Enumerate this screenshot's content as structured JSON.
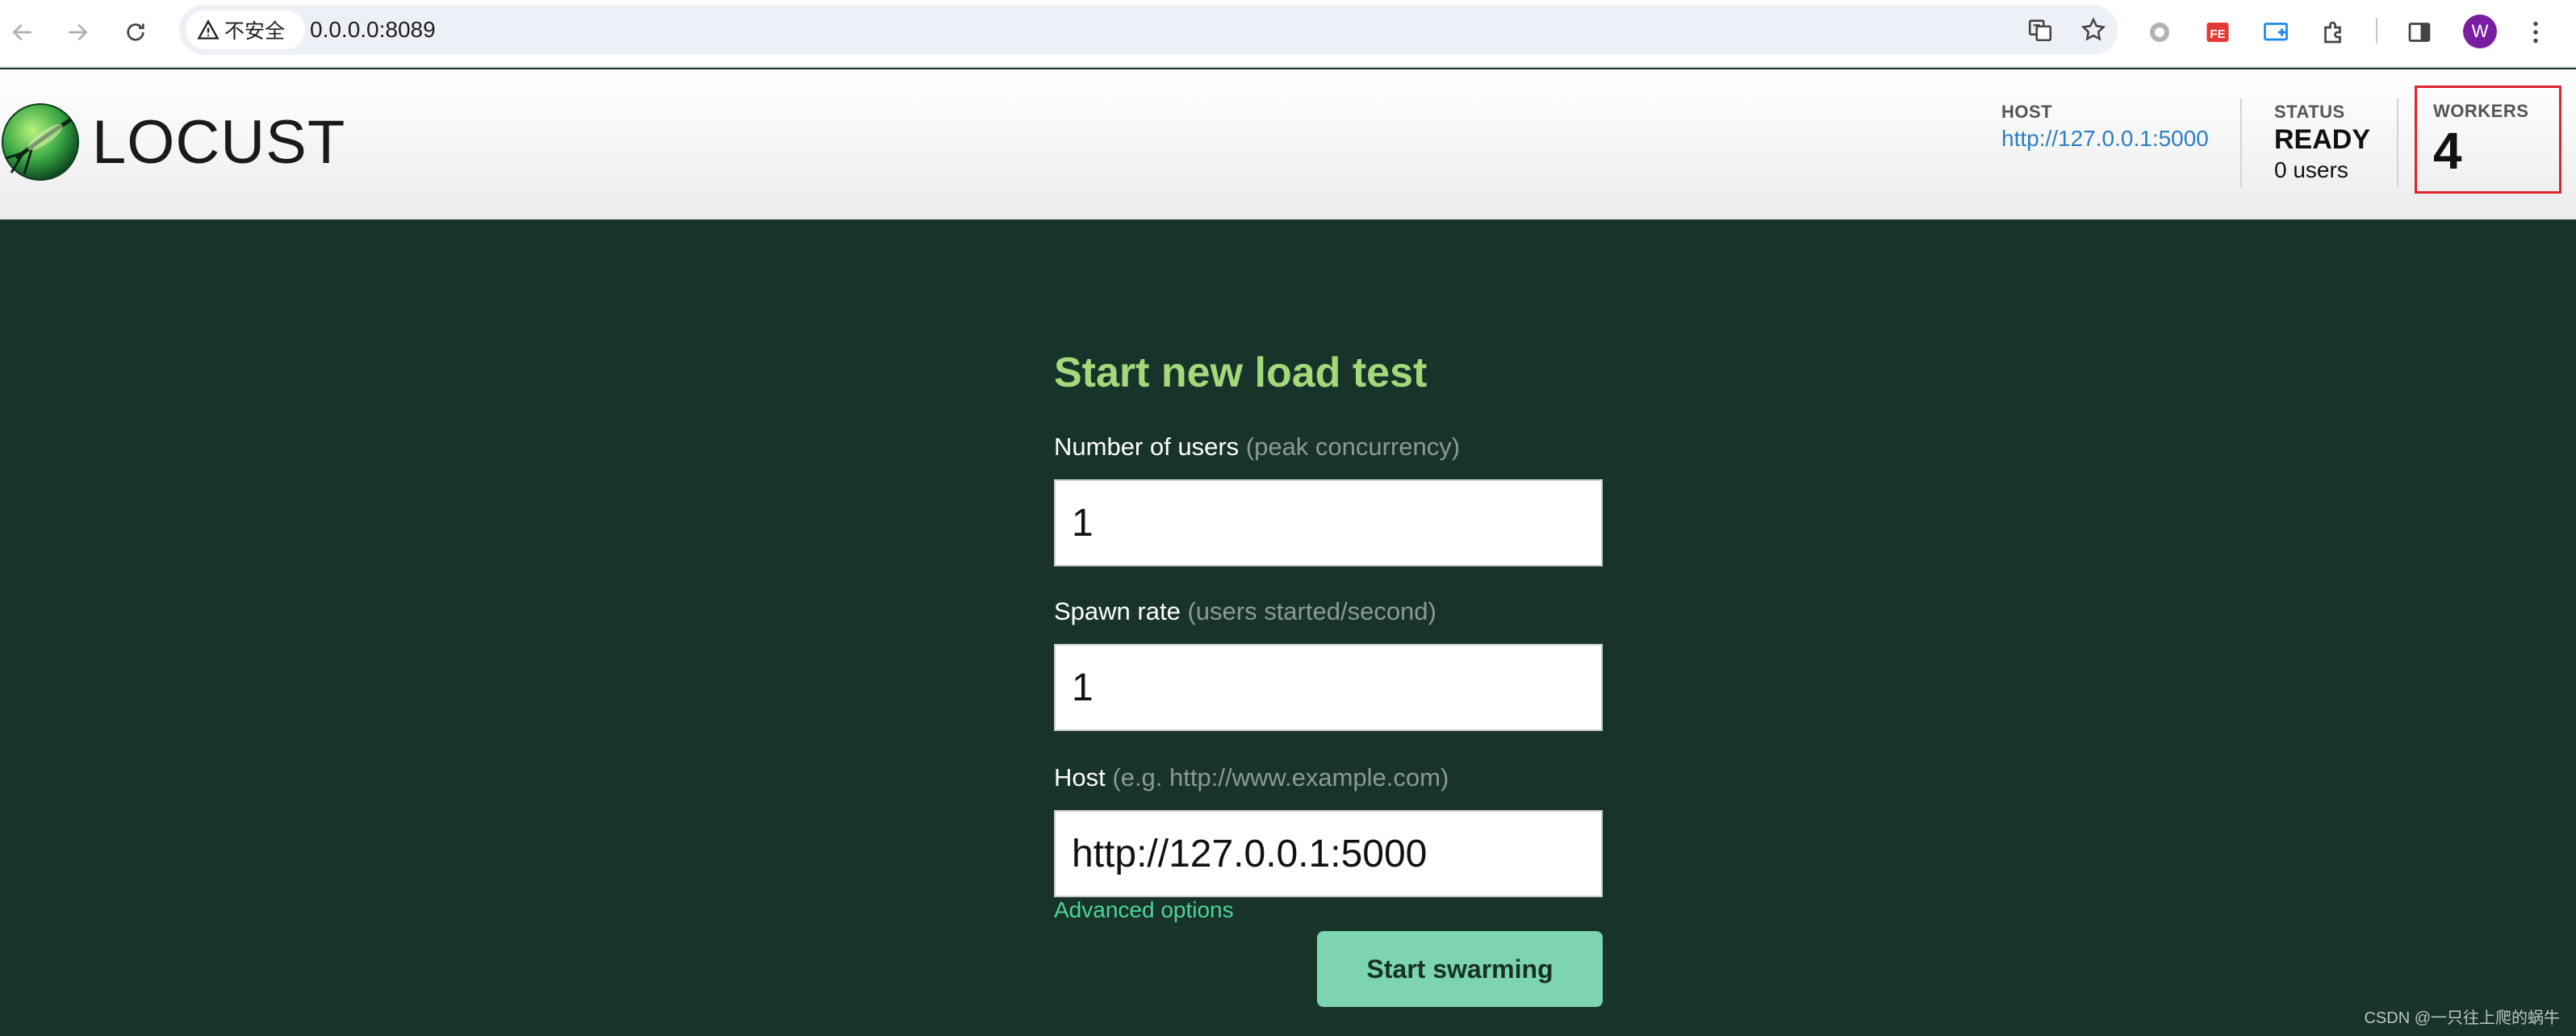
{
  "browser": {
    "security_label": "不安全",
    "url": "0.0.0.0:8089",
    "profile_initial": "W",
    "extension_badge": "FE"
  },
  "header": {
    "logo_text": "LOCUST",
    "host_label": "HOST",
    "host_value": "http://127.0.0.1:5000",
    "status_label": "STATUS",
    "status_value": "READY",
    "status_users": "0 users",
    "workers_label": "WORKERS",
    "workers_value": "4"
  },
  "form": {
    "title": "Start new load test",
    "users_label": "Number of users",
    "users_hint": "(peak concurrency)",
    "users_value": "1",
    "spawn_label": "Spawn rate",
    "spawn_hint": "(users started/second)",
    "spawn_value": "1",
    "host_label": "Host",
    "host_hint": "(e.g. http://www.example.com)",
    "host_value": "http://127.0.0.1:5000",
    "advanced_label": "Advanced options",
    "start_label": "Start swarming"
  },
  "watermark": "CSDN @一只往上爬的蜗牛",
  "colors": {
    "background": "#18332a",
    "title_green": "#a3d97a",
    "button_green": "#7dd4b0",
    "link_green": "#4fd399",
    "host_link_blue": "#2d7fc2",
    "highlight_red": "#e0242c"
  }
}
